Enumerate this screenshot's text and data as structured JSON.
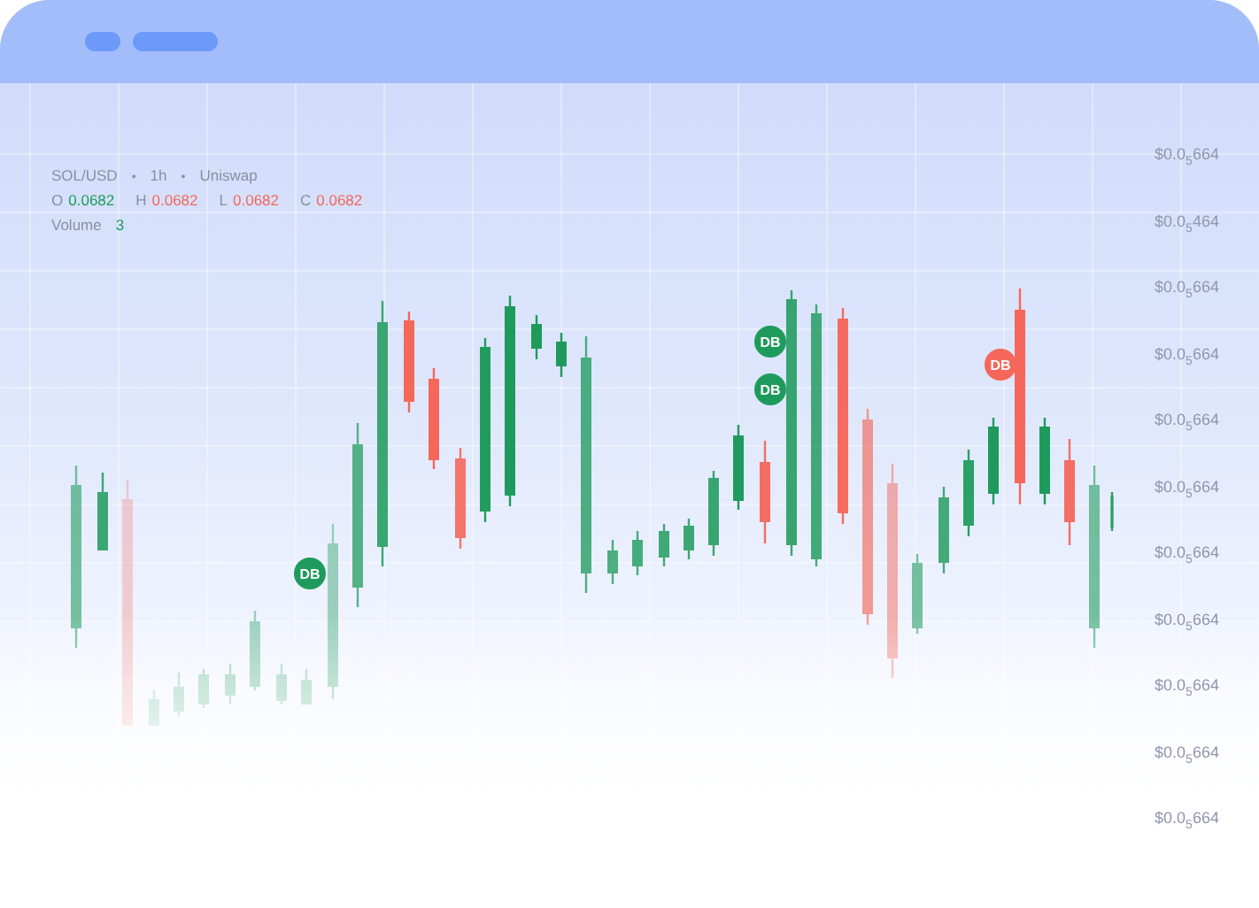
{
  "legend": {
    "symbol": "SOL/USD",
    "separator_1": "•",
    "interval": "1h",
    "separator_2": "•",
    "exchange": "Uniswap",
    "ohlc": [
      {
        "label": "O",
        "value": "0.0682",
        "color": "#1e9b5c"
      },
      {
        "label": "H",
        "value": "0.0682",
        "color": "#f5675a"
      },
      {
        "label": "L",
        "value": "0.0682",
        "color": "#f5675a"
      },
      {
        "label": "C",
        "value": "0.0682",
        "color": "#f5675a"
      }
    ],
    "volume": {
      "label": "Volume",
      "value": "3"
    }
  },
  "price_axis": {
    "labels": [
      "$0.0$_{5}$664",
      "$0.0$_{5}$464",
      "$0.0$_{5}$664",
      "$0.0$_{5}$664",
      "$0.0$_{5}$664",
      "$0.0$_{5}$664",
      "$0.0$_{5}$664",
      "$0.0$_{5}$664",
      "$0.0$_{5}$664",
      "$0.0$_{5}$664",
      "$0.0$_{5}$664"
    ]
  },
  "markers": [
    {
      "text": "DB",
      "color": "#1e9b5c"
    },
    {
      "text": "DB",
      "color": "#1e9b5c"
    },
    {
      "text": "DB",
      "color": "#1e9b5c"
    },
    {
      "text": "DB",
      "color": "#f5675a"
    }
  ]
}
